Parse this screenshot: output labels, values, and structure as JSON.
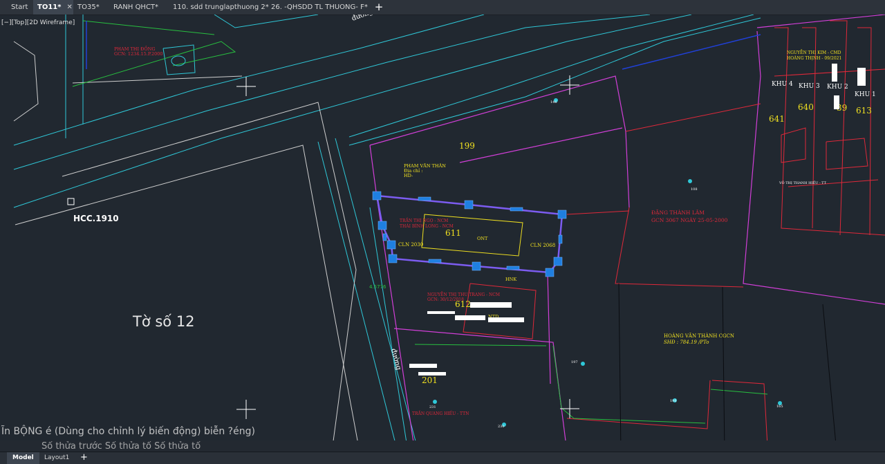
{
  "tabs": [
    {
      "label": "Start"
    },
    {
      "label": "TO11*",
      "close": "✕"
    },
    {
      "label": "TO35*"
    },
    {
      "label": "RANH QHCT*"
    },
    {
      "label": "110. sdd trunglapthuong 2*"
    },
    {
      "label": "26.  -QHSDD TL THUONG- F*"
    }
  ],
  "tab_add": "+",
  "viewport_label": "[−][Top][2D Wireframe]",
  "bottom_tabs": [
    {
      "label": "Model"
    },
    {
      "label": "Layout1"
    }
  ],
  "bottom_add": "+",
  "command_line": {
    "row1": "Ĩn BỘNG é (Dùng cho chỉnh lý biến động) biễn ?éng)",
    "row2": "Số thửa trước Số thửa tố Số thửa tố"
  },
  "drawing": {
    "sheet_label": "Tờ số 12",
    "hcc_label": "HCC.1910",
    "road_label_1": "đường",
    "road_label_2": "đường",
    "elevation": "4.5776",
    "parcels": {
      "p199": "199",
      "p611": "611",
      "p612": "612",
      "p201": "201",
      "p640": "640",
      "p641": "641",
      "p613": "613",
      "p639": "39"
    },
    "owners": {
      "pham_van_than": "PHAM VĂN THÂN",
      "dia_chi": "Địa chỉ :",
      "hd": "HD-",
      "tran_thi": "TRẦN THỊ NGỌ - NCM",
      "thai_binh_long": "THÁI BÌNH LONG - NCM",
      "nguyen_thi_thu_trang": "NGUYỄN THỊ THU TRANG - NCM",
      "gcn_612": "GCN: 30/12/2018",
      "dang_thanh_lam": "ĐẶNG THÀNH LÂM",
      "dang_gcn": "GCN 3067 NGÀY 25-05-2000",
      "hoang_van_thanh": "HOÀNG VĂN THÀNH  CGCN",
      "hoang_shd": "SHĐ : 784.19 /PTo",
      "nguyen_thi_kim": "NGUYỄN THỊ KIM - CMD",
      "hoang_thinh": "HOÀNG THỊNH - 09/2021",
      "vo_thi_thanh_hieu": "VÕ THỊ THANH HIẾU - TT",
      "tran_quang_hieu": "TRẦN QUANG HIẾU - TTN",
      "pham_thi_dong": "PHAM THỊ ĐỒNG",
      "pham_gcn": "GCN: 1234.15.P.2000"
    },
    "codes": {
      "cln_2030": "CLN 2030",
      "cln_2068": "CLN 2068",
      "ont": "ONT",
      "hnk": "HNK",
      "ntd": "NTD"
    },
    "zones": {
      "khu1": "KHU 1",
      "khu2": "KHU 2",
      "khu3": "KHU 3",
      "khu4": "KHU 4"
    },
    "marks": {
      "m1": "146",
      "m2": "108",
      "m3": "197",
      "m4": "198",
      "m5": "165",
      "m6": "231",
      "m7": "230"
    }
  },
  "colors": {
    "background": "#212830",
    "cyan": "#2fc8d8",
    "magenta": "#d23fd8",
    "red": "#e0283a",
    "yellow": "#f0e020",
    "grips": "#1f7fe0",
    "selection": "#7c5cf0",
    "green": "#28c040"
  }
}
